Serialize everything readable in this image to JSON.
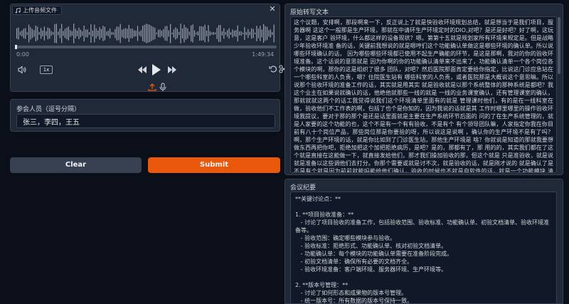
{
  "audio": {
    "label": "上传音频文件",
    "time_current": "0:00",
    "time_total": "1:49:34",
    "playback_rate": "1x",
    "progress": 0.0
  },
  "participants": {
    "title": "参会人员（逗号分隔）",
    "value": "张三，李四，王五"
  },
  "buttons": {
    "clear": "Clear",
    "submit": "Submit"
  },
  "transcript": {
    "title": "原始转写文本",
    "text": "这个议题，安排啊，那段啊来一下，反正说上了就是快验收环境规划总结，就是想当于是我们项目，服务器啊 这这个一般那是生产环境，那就在中请环生产环境定时的DIO,对吧？是还是好吧？好了啊，这玩意，这是客户 验环境，什么都这样的设备现状？嗯。第第十五就是规划家所有环境来规定是。但是战略少年验收环境准 备的话，关键前我想说的就是嗯哼们这个功能确认单做这是哪些环境的确认单。所以说哪些环境确认的话， 因为哪些哪些环境都已使用不起生产确能的环节，是这是那啊，我对的你的验收环境准备。这个话说的意思就是 因为你啊的你的功能确认清单来不出来了，功能确认清单一个各个岗位各个模块的啊，那你的这是组织了很多 团队，对吧？然后医院那面肯定要给你指定，比说这门诊应急站在一个哪些科室的人负责，嗯？住院医生站有 哪些科室的人负责，或者医院那是大概说这个意思嘛。所以说那个验收环境的准备工作的话，其实就是用其实 就是验收就是以那个系统整体的那种系统是都吧？我这个业主在如果说就确认的话，他绝他就那些一线的就是 一线的业务课室确认，还有管理课室的确认，那就就就这两个的话工我觉得说我们这个环境清单里面有的就是 管理课时他们，有的是在一线科室在做，验收他们不工作表的啊，包括了也个是你知的，因为我说的话就是其 工作时哪里哪里的操作验收环境我提议，要对于那的那个是还是话里面就是主要在生产系统环节后面的 问的了在生产系统管理的，就是人家要的这个功能的也，这个不是有一个有有验收，不是有个 有个领导团队嘛，人家指定你我在你目前有八十个岗位产品，那些岗位那是你要验的呀，所以说这是说啊 ，确认你的生产环境不是有了吗？啊，那个生产环境的话，就是你比如到了门诊医生站，那他生产环境是 啥？你就说是知道的那就我要想做东西再把你吧，拒绝加把这个加把拒绝病历，是吧？是的，那都有了，那 用的的，其实我们都在了这个就是直接在这能做一下，就直接发给他们，那才我们操加验收的那，但这个就是 只是准验收，就是说就是准备以这些调他们去打分。你那个需要或就是讨不次，就是验收的话，就是刚才说的 就是确认了是不是有个就是因为前前就能吗能给他们确认，验收的时候也不就是自软件的话，就是一个功能模块 清单，通过不通过是吧？对，那个就是那个首先是你的验收的你，你对吧那个准备出来嘛，整个医生是吧？ 啊，你那个就是那个每个系统的那边道就要做快清单，最后后面也有个词这个确定，对吧，然后那是个的工作。"
  },
  "minutes": {
    "title": "会议纪要",
    "text": "**关键讨论点：**\n\n1. **项目验收准备：**\n   - 讨论了项目验收的准备工作，包括验收范围、验收标准、功能确认单、初验文档清单、验收环境准备等。\n   - 验收范围：确定哪些模块参与验收。\n   - 验收标准：拒绝形式、功能确认单、核对初验文档清单。\n   - 功能确认单：每个模块的功能确认单需要在准备阶段完成。\n   - 初验文档清单：确保所有必要的文档齐全。\n   - 验收环境准备：客户端环境、服务器环境、生产环境等。\n\n2. **版本号管理：**\n   - 讨论了如何形态和成果物的版本号管理。\n   - 统一版本号：所有数据的版本号保持一致。\n   - 错位版本号：不同层级的数据版本号可以独立变化。\n   - 版本号变化规则：根据业务、事项域、工作事项、工序的变化来确定版本号的变化。"
  },
  "colors": {
    "accent": "#ea580c",
    "background": "#0b0f19",
    "panel": "#1f2937"
  },
  "icons": [
    "music-icon",
    "close-icon",
    "volume-icon",
    "rewind-icon",
    "play-icon",
    "forward-icon",
    "undo-icon",
    "scissors-icon",
    "upload-icon",
    "microphone-icon"
  ]
}
